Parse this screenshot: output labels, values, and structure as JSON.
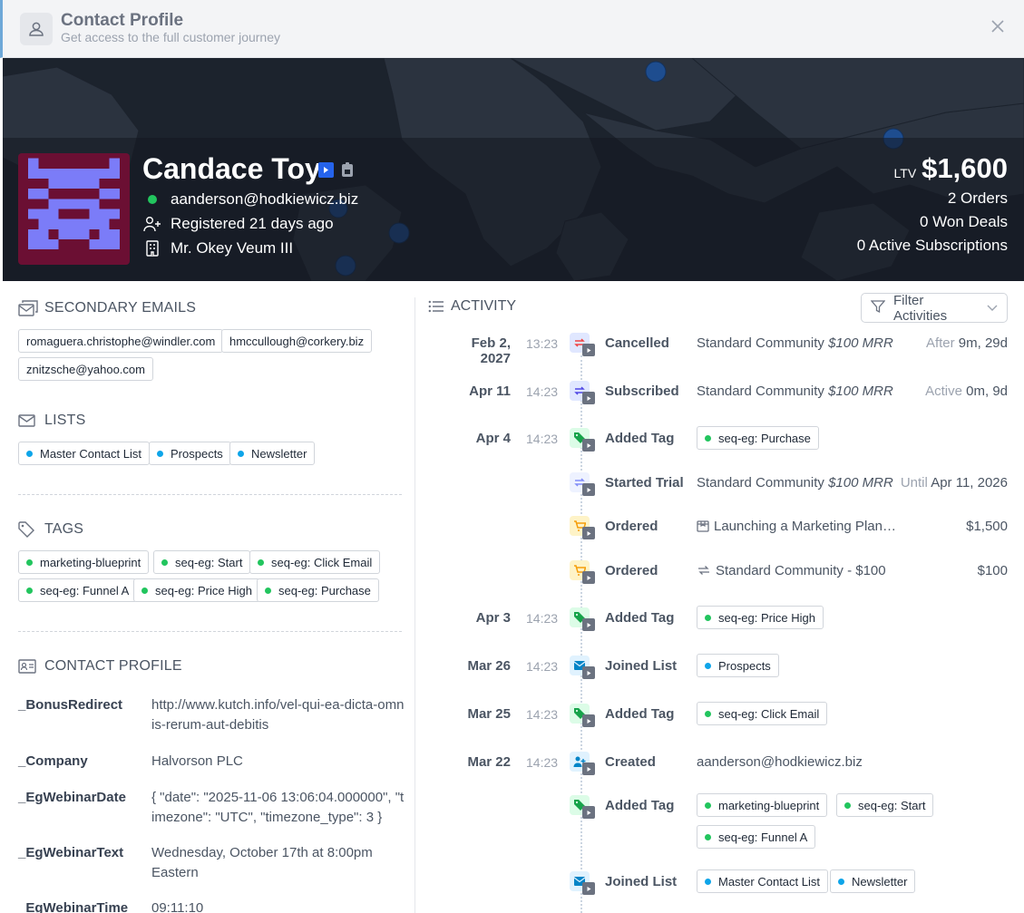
{
  "modal": {
    "title": "Contact Profile",
    "subtitle": "Get access to the full customer journey"
  },
  "contact": {
    "name": "Candace Toy",
    "email": "aanderson@hodkiewicz.biz",
    "registered": "Registered 21 days ago",
    "company_contact": "Mr. Okey Veum III",
    "ltv_label": "LTV",
    "ltv_value": "$1,600",
    "orders": "2 Orders",
    "won_deals": "0 Won Deals",
    "active_subscriptions": "0 Active Subscriptions"
  },
  "secondary_emails": {
    "title": "SECONDARY EMAILS",
    "items": [
      "romaguera.christophe@windler.com",
      "hmccullough@corkery.biz",
      "znitzsche@yahoo.com"
    ]
  },
  "lists": {
    "title": "LISTS",
    "items": [
      "Master Contact List",
      "Prospects",
      "Newsletter"
    ]
  },
  "tags": {
    "title": "TAGS",
    "items": [
      "marketing-blueprint",
      "seq-eg: Start",
      "seq-eg: Click Email",
      "seq-eg: Funnel A",
      "seq-eg: Price High",
      "seq-eg: Purchase"
    ]
  },
  "profile": {
    "title": "CONTACT PROFILE",
    "fields": [
      {
        "key": "_BonusRedirect",
        "value": "http://www.kutch.info/vel-qui-ea-dicta-omnis-rerum-aut-debitis"
      },
      {
        "key": "_Company",
        "value": "Halvorson PLC"
      },
      {
        "key": "_EgWebinarDate",
        "value": "{ \"date\": \"2025-11-06 13:06:04.000000\", \"timezone\": \"UTC\", \"timezone_type\": 3 }"
      },
      {
        "key": "_EgWebinarText",
        "value": "Wednesday, October 17th at 8:00pm Eastern"
      },
      {
        "key": "_EgWebinarTime",
        "value": "09:11:10"
      }
    ]
  },
  "activity": {
    "title": "ACTIVITY",
    "filter_label": "Filter Activities",
    "events": [
      {
        "date": "Feb 2, 2027",
        "time": "13:23",
        "type": "Cancelled",
        "desc": "Standard Community",
        "mrr": "$100 MRR",
        "right_muted": "After",
        "right": "9m, 29d"
      },
      {
        "date": "Apr 11",
        "time": "14:23",
        "type": "Subscribed",
        "desc": "Standard Community",
        "mrr": "$100 MRR",
        "right_muted": "Active",
        "right": "0m, 9d"
      },
      {
        "date": "Apr 4",
        "time": "14:23",
        "type": "Added Tag",
        "chips": [
          "seq-eg: Purchase"
        ]
      },
      {
        "date": "",
        "time": "",
        "type": "Started Trial",
        "desc": "Standard Community",
        "mrr": "$100 MRR",
        "right_muted": "Until",
        "right": "Apr 11, 2026"
      },
      {
        "date": "",
        "time": "",
        "type": "Ordered",
        "desc": "Launching a Marketing Plan…",
        "right": "$1,500"
      },
      {
        "date": "",
        "time": "",
        "type": "Ordered",
        "desc": "Standard Community - $100",
        "right": "$100"
      },
      {
        "date": "Apr 3",
        "time": "14:23",
        "type": "Added Tag",
        "chips": [
          "seq-eg: Price High"
        ]
      },
      {
        "date": "Mar 26",
        "time": "14:23",
        "type": "Joined List",
        "chips": [
          "Prospects"
        ]
      },
      {
        "date": "Mar 25",
        "time": "14:23",
        "type": "Added Tag",
        "chips": [
          "seq-eg: Click Email"
        ]
      },
      {
        "date": "Mar 22",
        "time": "14:23",
        "type": "Created",
        "desc": "aanderson@hodkiewicz.biz"
      },
      {
        "date": "",
        "time": "",
        "type": "Added Tag",
        "chips": [
          "marketing-blueprint",
          "seq-eg: Start",
          "seq-eg: Funnel A"
        ]
      },
      {
        "date": "",
        "time": "",
        "type": "Joined List",
        "chips": [
          "Master Contact List",
          "Newsletter"
        ]
      }
    ]
  },
  "colors": {
    "accent": "#2563eb",
    "green": "#22c55e",
    "blue_dot": "#0ea5e9",
    "hero_bg": "#1c232d",
    "avatar_bg": "#6b0f33",
    "avatar_fg": "#7b7cf8"
  },
  "icons": [
    "user-icon",
    "close-icon",
    "play-badge-icon",
    "lock-badge-icon",
    "user-plus-icon",
    "building-icon",
    "emails-icon",
    "mail-icon",
    "tag-icon",
    "id-card-icon",
    "list-icon",
    "filter-icon",
    "chevron-down-icon",
    "cart-icon",
    "refresh-icon",
    "package-icon"
  ]
}
